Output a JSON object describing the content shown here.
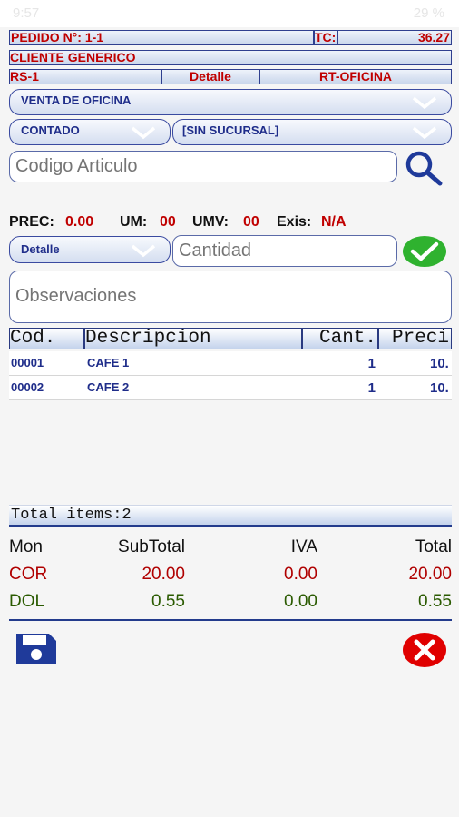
{
  "status_bar": {
    "time": "9:57",
    "battery": "29 %"
  },
  "header": {
    "pedido_label": "PEDIDO N°: 1-1",
    "tc_label": "TC:",
    "tc_value": "36.27",
    "client": "CLIENTE GENERICO",
    "rs": "RS-1",
    "detalle": "Detalle",
    "rt": "RT-OFICINA"
  },
  "selects": {
    "venta": "VENTA DE OFICINA",
    "payment": "CONTADO",
    "sucursal": "[SIN SUCURSAL]",
    "price_type": "Detalle"
  },
  "inputs": {
    "codigo_placeholder": "Codigo Articulo",
    "cantidad_placeholder": "Cantidad",
    "observaciones_placeholder": "Observaciones"
  },
  "info": {
    "prec_label": "PREC:",
    "prec_value": "0.00",
    "um_label": "UM:",
    "um_value": "00",
    "umv_label": "UMV:",
    "umv_value": "00",
    "exis_label": "Exis:",
    "exis_value": "N/A"
  },
  "table": {
    "headers": [
      "Cod.",
      "Descripcion",
      "Cant.",
      "Preci"
    ],
    "rows": [
      {
        "cod": "00001",
        "desc": "CAFE 1",
        "cant": "1",
        "precio": "10."
      },
      {
        "cod": "00002",
        "desc": "CAFE 2",
        "cant": "1",
        "precio": "10."
      }
    ]
  },
  "totals": {
    "items_text": "Total items:2",
    "headers": {
      "mon": "Mon",
      "subtotal": "SubTotal",
      "iva": "IVA",
      "total": "Total"
    },
    "rows": [
      {
        "mon": "COR",
        "subtotal": "20.00",
        "iva": "0.00",
        "total": "20.00",
        "color": "#b00000"
      },
      {
        "mon": "DOL",
        "subtotal": "0.55",
        "iva": "0.00",
        "total": "0.55",
        "color": "#2a5a00"
      }
    ]
  },
  "colors": {
    "accent_blue": "#1f2d8a",
    "red": "#c00000",
    "green_check": "#2fb22f",
    "red_cancel": "#e00000"
  },
  "icons": {
    "search": "search-icon",
    "check": "check-icon",
    "save": "save-icon",
    "cancel": "cancel-icon"
  }
}
